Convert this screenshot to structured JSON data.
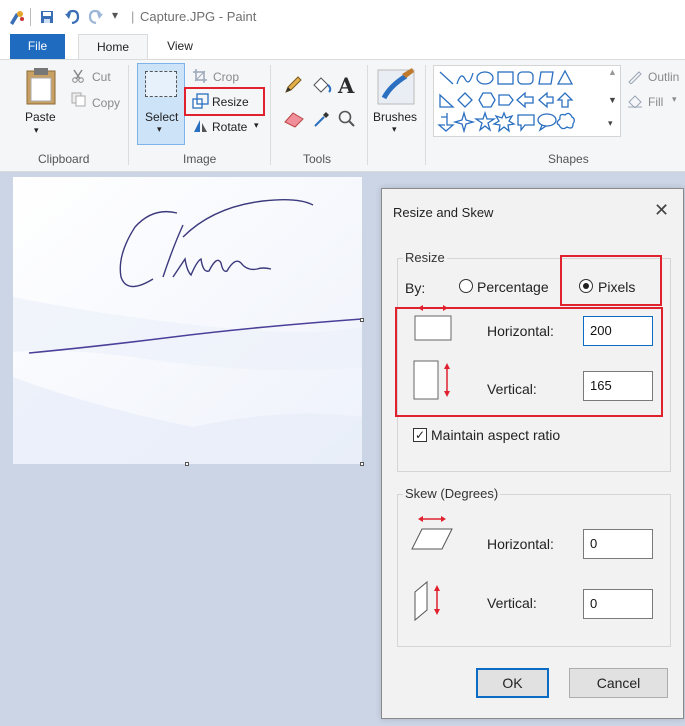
{
  "window": {
    "title": "Capture.JPG - Paint"
  },
  "tabs": [
    {
      "label": "File"
    },
    {
      "label": "Home"
    },
    {
      "label": "View"
    }
  ],
  "ribbon": {
    "clipboard": {
      "paste": "Paste",
      "cut": "Cut",
      "copy": "Copy",
      "group": "Clipboard"
    },
    "image": {
      "select": "Select",
      "crop": "Crop",
      "resize": "Resize",
      "rotate": "Rotate",
      "group": "Image"
    },
    "tools": {
      "group": "Tools",
      "text_tool": "A"
    },
    "brushes": {
      "label": "Brushes"
    },
    "shapes": {
      "group": "Shapes",
      "outline": "Outlin",
      "fill": "Fill"
    }
  },
  "dialog": {
    "title": "Resize and Skew",
    "resize": {
      "legend": "Resize",
      "by_label": "By:",
      "percentage_label": "Percentage",
      "pixels_label": "Pixels",
      "selected_unit": "Pixels",
      "horizontal_label": "Horizontal:",
      "horizontal_value": "200",
      "vertical_label": "Vertical:",
      "vertical_value": "165"
    },
    "maintain_aspect": {
      "label": "Maintain aspect ratio",
      "checked": true
    },
    "skew": {
      "legend": "Skew (Degrees)",
      "horizontal_label": "Horizontal:",
      "horizontal_value": "0",
      "vertical_label": "Vertical:",
      "vertical_value": "0"
    },
    "ok_label": "OK",
    "cancel_label": "Cancel"
  },
  "colors": {
    "accent": "#1e6bc0",
    "highlight_box": "#e0212e",
    "workspace": "#cbd5e6",
    "ribbon": "#f5f6f7"
  }
}
